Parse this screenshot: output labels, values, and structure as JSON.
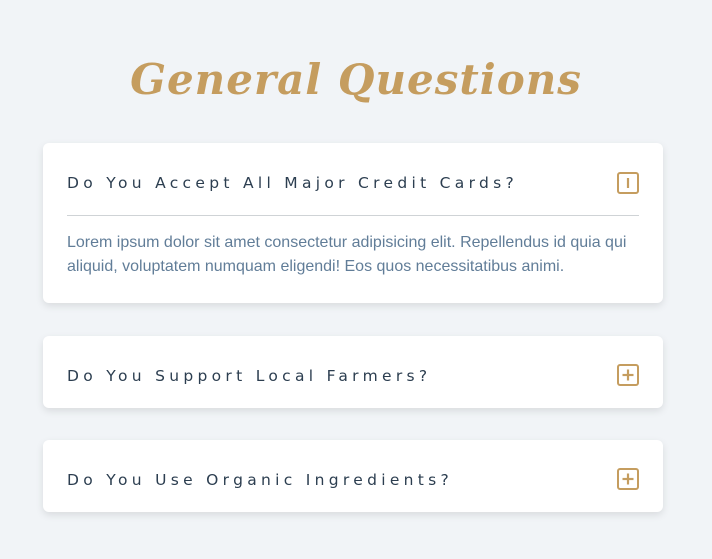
{
  "page": {
    "title": "General Questions"
  },
  "faq": {
    "items": [
      {
        "question": "Do You Accept All Major Credit Cards?",
        "answer": "Lorem ipsum dolor sit amet consectetur adipisicing elit. Repellendus id quia qui aliquid, voluptatem numquam eligendi! Eos quos necessitatibus animi.",
        "expanded": true,
        "toggle_icon": "minus-square-icon"
      },
      {
        "question": "Do You Support Local Farmers?",
        "expanded": false,
        "toggle_icon": "plus-square-icon"
      },
      {
        "question": "Do You Use Organic Ingredients?",
        "expanded": false,
        "toggle_icon": "plus-square-icon"
      }
    ]
  },
  "colors": {
    "background": "#f1f4f7",
    "accent": "#c59d5f",
    "question_text": "#2c3e50",
    "answer_text": "#617d98",
    "card": "#ffffff"
  }
}
